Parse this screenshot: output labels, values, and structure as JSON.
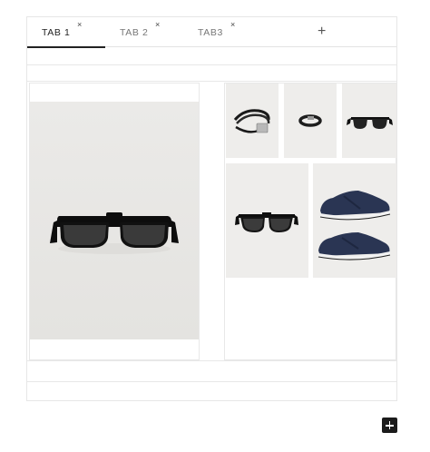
{
  "tabs": [
    {
      "label": "TAB 1",
      "active": true,
      "close_icon": "×"
    },
    {
      "label": "TAB 2",
      "active": false,
      "close_icon": "×"
    },
    {
      "label": "TAB3",
      "active": false,
      "close_icon": "×"
    }
  ],
  "add_tab_icon": "+",
  "colors": {
    "accent": "#222222",
    "border": "#e6e6e6",
    "photo_background": "#eeedeb",
    "fab_background": "#1b1b1b"
  },
  "images": {
    "large": "sunglasses-icon",
    "grid": [
      "bracelet-icon",
      "ring-icon",
      "sunglasses-icon",
      "sunglasses-icon",
      "sneakers-icon"
    ]
  }
}
